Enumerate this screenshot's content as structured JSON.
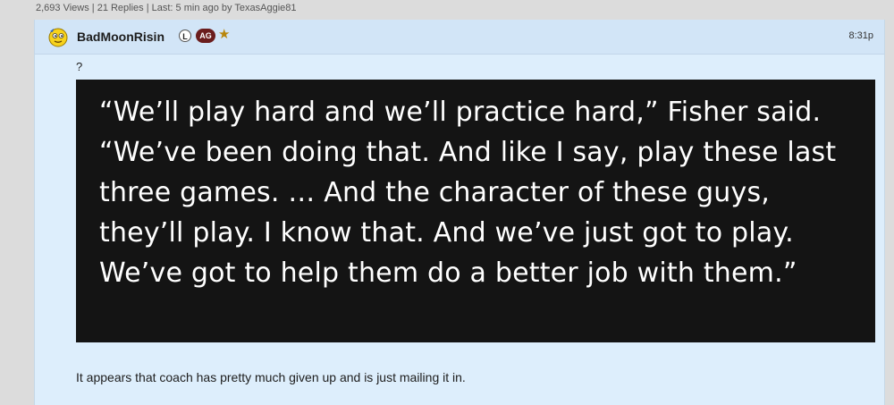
{
  "thread_meta": {
    "text": "2,693 Views | 21 Replies | Last: 5 min ago by TexasAggie81"
  },
  "post": {
    "username": "BadMoonRisin",
    "badge_l": "L",
    "badge_ag": "AG",
    "time": "8:31p",
    "question": "?",
    "quote_image_text": "“We’ll play hard and we’ll practice hard,” Fisher said. “We’ve been doing that. And like I say, play these last three games. … And the character of these guys, they’ll play. I know that. And we’ve just got to play. We’ve got to help them do a better job with them.”",
    "body": "It appears that coach has pretty much given up and is just mailing it in.",
    "star_icon": "★"
  },
  "colors": {
    "post_bg": "#ddeefc",
    "header_bg": "#d2e5f7",
    "badge_ag": "#6b1d1d",
    "star": "#b8860b",
    "quote_bg": "#141414"
  }
}
